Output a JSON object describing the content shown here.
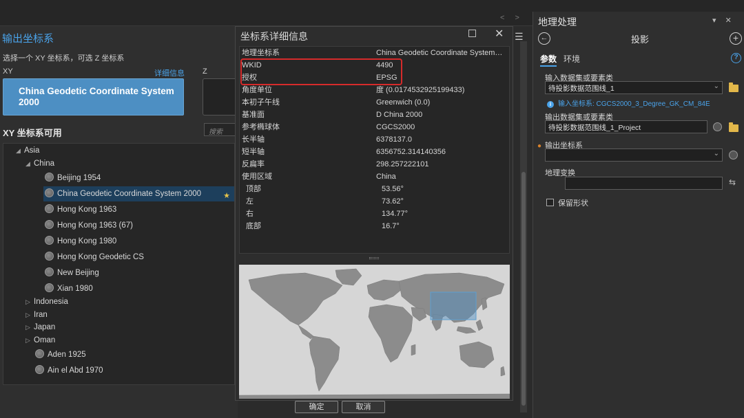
{
  "top": {
    "nav_arrows": "< >"
  },
  "left": {
    "title": "输出坐标系",
    "subtitle": "选择一个 XY 坐标系，可选 Z 坐标系",
    "xy_label": "XY",
    "detail_link": "详细信息",
    "z_label": "Z",
    "selected_line1": "China Geodetic Coordinate System",
    "selected_line2": "2000",
    "available_label": "XY 坐标系可用",
    "search_placeholder": "搜索",
    "tree": {
      "asia": "Asia",
      "china": "China",
      "leaves": [
        "Beijing 1954",
        "China Geodetic Coordinate System 2000",
        "Hong Kong 1963",
        "Hong Kong 1963 (67)",
        "Hong Kong 1980",
        "Hong Kong Geodetic CS",
        "New Beijing",
        "Xian 1980"
      ],
      "countries": [
        "Indonesia",
        "Iran",
        "Japan",
        "Oman"
      ],
      "oman_leaves": [
        "Aden 1925",
        "Ain el Abd 1970"
      ]
    }
  },
  "popup": {
    "title": "坐标系详细信息",
    "props": [
      {
        "k": "地理坐标系",
        "v": "China Geodetic Coordinate System…"
      },
      {
        "k": "WKID",
        "v": "4490"
      },
      {
        "k": "授权",
        "v": "EPSG"
      },
      {
        "k": "角度单位",
        "v": "度 (0.0174532925199433)"
      },
      {
        "k": "本初子午线",
        "v": "Greenwich (0.0)"
      },
      {
        "k": "基准面",
        "v": "D China 2000"
      },
      {
        "k": "参考椭球体",
        "v": "CGCS2000"
      },
      {
        "k": "长半轴",
        "v": "6378137.0"
      },
      {
        "k": "短半轴",
        "v": "6356752.314140356"
      },
      {
        "k": "反扁率",
        "v": "298.257222101"
      },
      {
        "k": "使用区域",
        "v": "China"
      },
      {
        "k": "顶部",
        "v": "53.56°"
      },
      {
        "k": "左",
        "v": "73.62°"
      },
      {
        "k": "右",
        "v": "134.77°"
      },
      {
        "k": "底部",
        "v": "16.7°"
      }
    ],
    "ok": "确定",
    "cancel": "取消"
  },
  "right": {
    "title": "地理处理",
    "pin_icons": "▾ ✕",
    "tool": "投影",
    "tab_params": "参数",
    "tab_env": "环境",
    "input_label": "输入数据集或要素类",
    "input_value": "待投影数据范围线_1",
    "info_text": "输入坐标系: CGCS2000_3_Degree_GK_CM_84E",
    "output_label": "输出数据集或要素类",
    "output_value": "待投影数据范围线_1_Project",
    "out_cs_label": "输出坐标系",
    "out_cs_value": "",
    "geo_transform_label": "地理变换",
    "preserve_shape": "保留形状"
  },
  "colors": {
    "accent": "#4aa3ea",
    "selected_bg": "#4d8fc3",
    "highlight_box": "#d62b2b",
    "warning": "#d9822b"
  }
}
